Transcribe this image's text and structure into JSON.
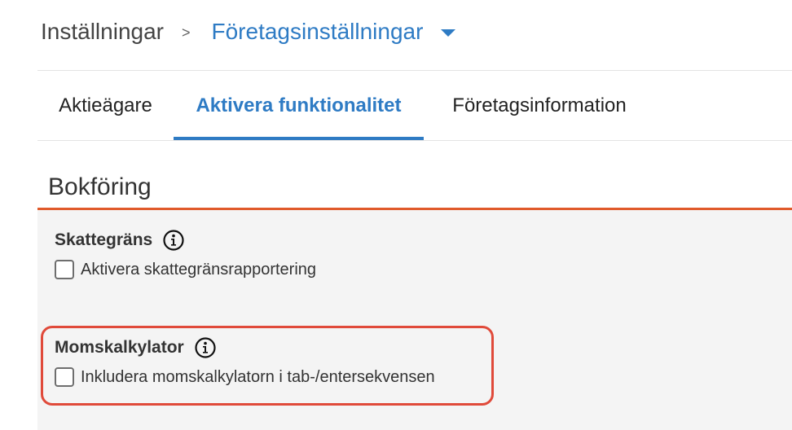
{
  "breadcrumb": {
    "root": "Inställningar",
    "separator": ">",
    "current": "Företagsinställningar"
  },
  "tabs": [
    {
      "label": "Aktieägare",
      "active": false
    },
    {
      "label": "Aktivera funktionalitet",
      "active": true
    },
    {
      "label": "Företagsinformation",
      "active": false
    }
  ],
  "section": {
    "title": "Bokföring",
    "groups": [
      {
        "label": "Skattegräns",
        "icon": "info-icon",
        "checkbox_label": "Aktivera skattegränsrapportering",
        "checked": false
      },
      {
        "label": "Momskalkylator",
        "icon": "info-icon",
        "checkbox_label": "Inkludera momskalkylatorn i tab-/entersekvensen",
        "checked": false
      }
    ]
  },
  "colors": {
    "accent": "#2e7bc4",
    "section_rule": "#e05a2b",
    "highlight": "#e04a3a",
    "body_bg": "#f4f4f4"
  }
}
